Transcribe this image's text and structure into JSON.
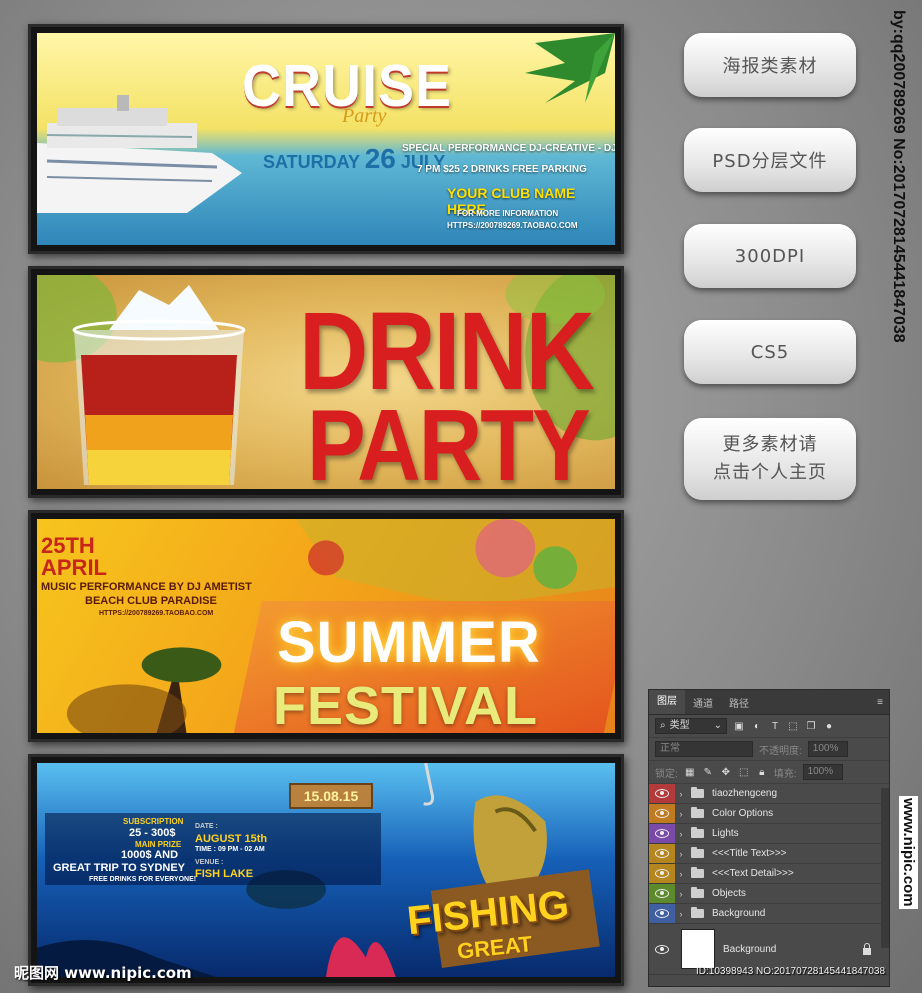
{
  "posters": {
    "cruise": {
      "title": "CRUISE",
      "subtitle": "Party",
      "date_prefix": "SATURDAY",
      "date_day": "26",
      "date_month": "JULY",
      "line1": "SPECIAL PERFORMANCE DJ-CREATIVE - DJ CREATIVE",
      "line2": "7 PM    $25    2 DRINKS    FREE PARKING",
      "club": "YOUR CLUB NAME HERE",
      "line3": "FOR MORE INFORMATION",
      "url": "HTTPS://200789269.TAOBAO.COM"
    },
    "drink": {
      "line1": "DRINK",
      "line2": "PARTY"
    },
    "summer": {
      "date_day": "25TH",
      "date_month": "APRIL",
      "performance": "MUSIC PERFORMANCE BY DJ AMETIST",
      "venue": "BEACH CLUB PARADISE",
      "url": "HTTPS://200789269.TAOBAO.COM",
      "title1": "SUMMER",
      "title2": "FESTIVAL"
    },
    "fishing": {
      "sign_date": "15.08.15",
      "subscription_label": "SUBSCRIPTION",
      "subscription_value": "25 - 300$",
      "prize_label": "MAIN PRIZE",
      "prize_value1": "1000$ AND",
      "prize_value2": "GREAT TRIP TO SYDNEY",
      "free_drinks": "FREE DRINKS FOR EVERYONE!",
      "date_label": "DATE :",
      "date_value": "AUGUST 15th",
      "time_value": "TIME : 09 PM - 02 AM",
      "venue_label": "VENUE :",
      "venue_value": "FISH LAKE",
      "title": "FISHING",
      "subtitle": "GREAT"
    }
  },
  "side_buttons": [
    {
      "label": "海报类素材"
    },
    {
      "label": "PSD分层文件"
    },
    {
      "label": "300DPI"
    },
    {
      "label": "CS5"
    },
    {
      "label_line1": "更多素材请",
      "label_line2": "点击个人主页"
    }
  ],
  "watermarks": {
    "right_vertical": "by:qq200789269 No:20170728145441847038",
    "right_url": "www.nipic.com",
    "footer_logo": "昵图网 www.nipic.com",
    "footer_id": "ID:10398943 NO:20170728145441847038"
  },
  "layers_panel": {
    "tabs": [
      "图层",
      "通道",
      "路径"
    ],
    "filter_type": "类型",
    "blend_mode": "正常",
    "opacity_label": "不透明度:",
    "opacity_value": "100%",
    "lock_label": "锁定:",
    "fill_label": "填充:",
    "fill_value": "100%",
    "layers": [
      {
        "name": "tiaozhengceng",
        "color": "#b33a3a"
      },
      {
        "name": "Color Options",
        "color": "#c07a22"
      },
      {
        "name": "Lights",
        "color": "#7a4aa8"
      },
      {
        "name": "<<<Title Text>>>",
        "color": "#b5851f"
      },
      {
        "name": "<<<Text Detail>>>",
        "color": "#b5851f"
      },
      {
        "name": "Objects",
        "color": "#5e8a2e"
      },
      {
        "name": "Background",
        "color": "#3f5fa0"
      }
    ],
    "base_layer": "Background"
  }
}
